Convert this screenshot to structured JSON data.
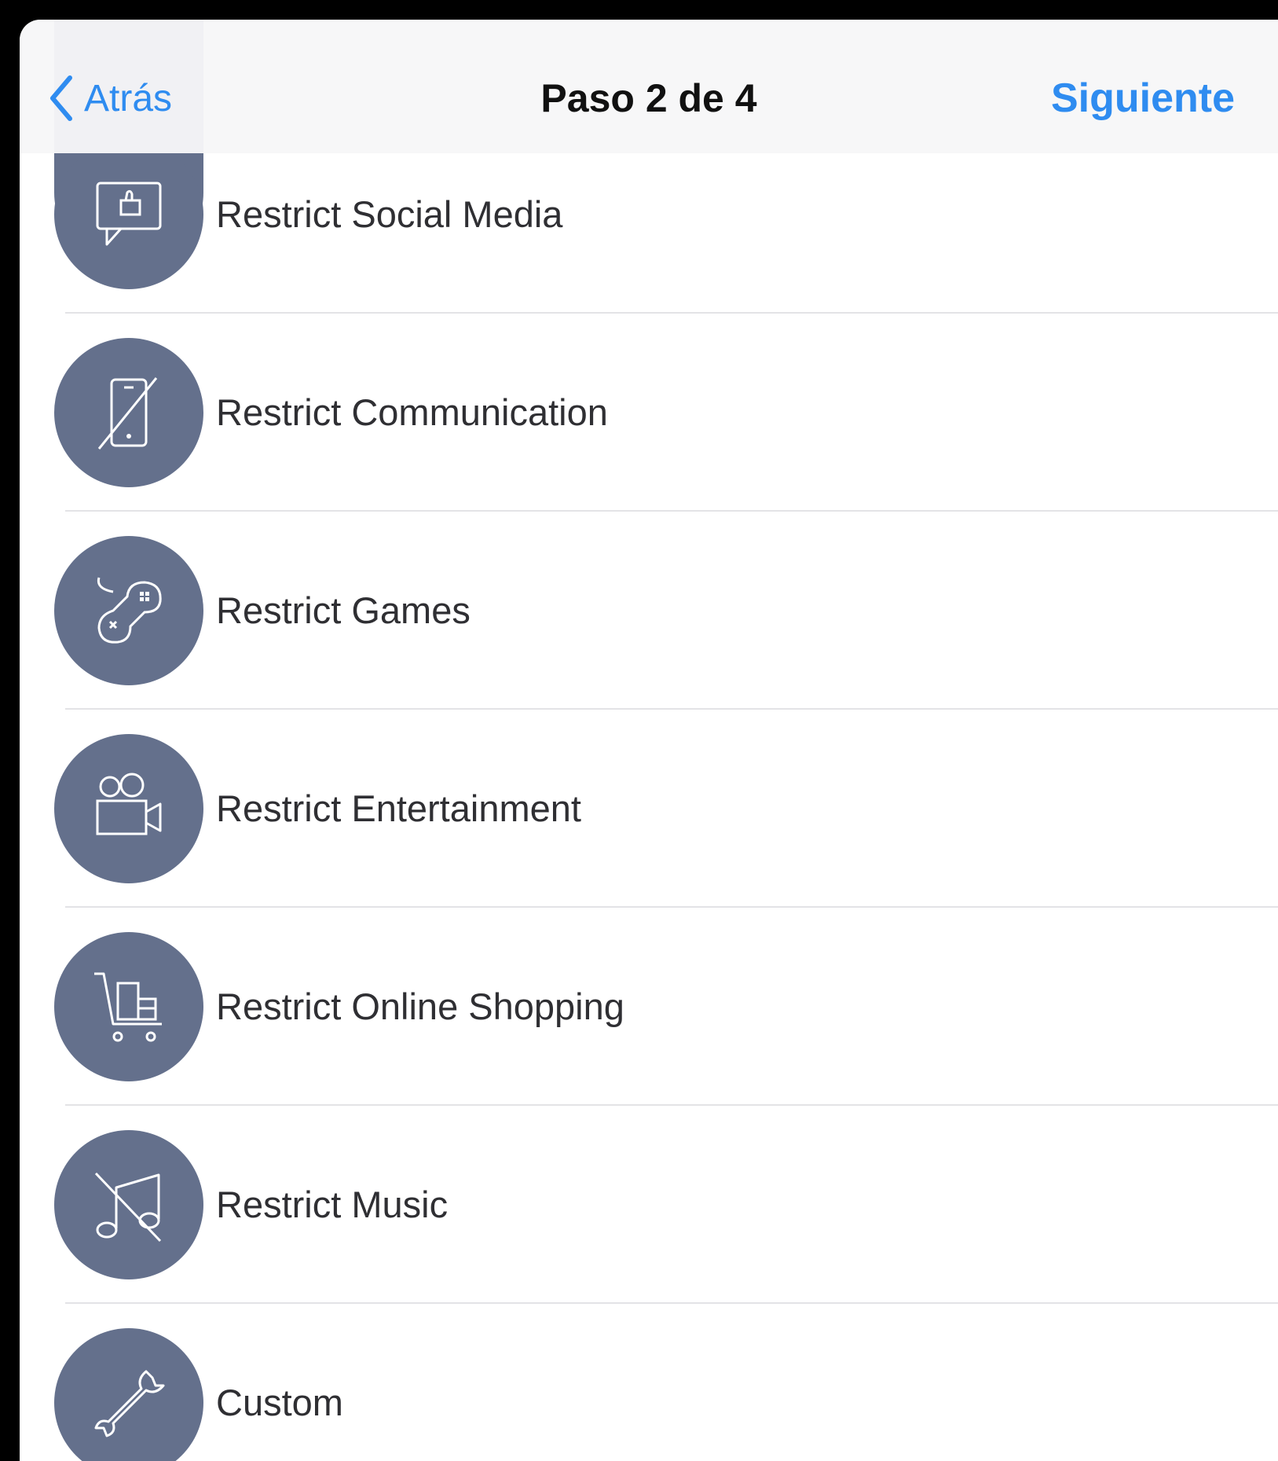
{
  "navbar": {
    "back_label": "Atrás",
    "title": "Paso 2 de 4",
    "next_label": "Siguiente",
    "accent_color": "#2f8cf0"
  },
  "options": [
    {
      "label": "Restrict Social Media",
      "icon": "social-media-like-icon"
    },
    {
      "label": "Restrict Communication",
      "icon": "phone-blocked-icon"
    },
    {
      "label": "Restrict Games",
      "icon": "game-controller-icon"
    },
    {
      "label": "Restrict Entertainment",
      "icon": "video-camera-icon"
    },
    {
      "label": "Restrict Online Shopping",
      "icon": "shopping-cart-icon"
    },
    {
      "label": "Restrict Music",
      "icon": "music-blocked-icon"
    },
    {
      "label": "Custom",
      "icon": "wrench-icon"
    }
  ],
  "icon_circle_color": "#64708c"
}
